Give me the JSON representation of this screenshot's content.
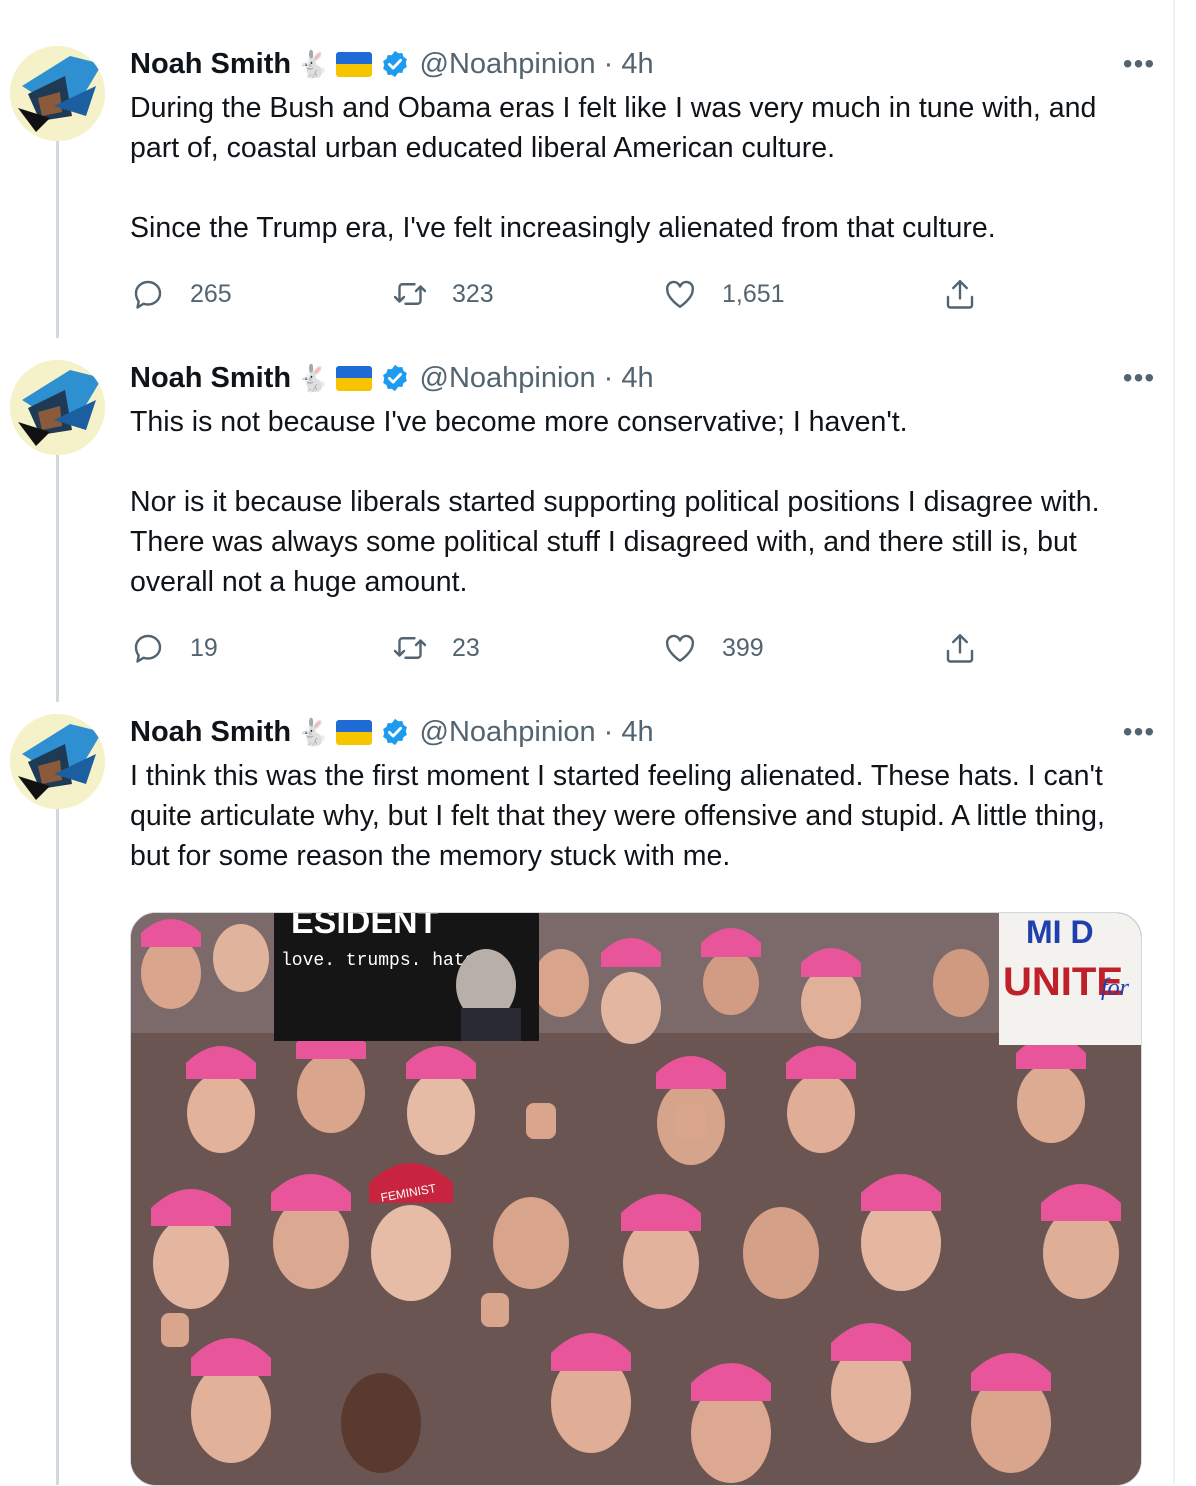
{
  "tweets": [
    {
      "name": "Noah Smith",
      "emoji_rabbit": "🐇",
      "handle": "@Noahpinion",
      "time": "· 4h",
      "more": "•••",
      "paragraphs": [
        "During the Bush and Obama eras I felt like I was very much in tune with, and part of, coastal urban educated liberal American culture.",
        "Since the Trump era, I've felt increasingly alienated from that culture."
      ],
      "replies": "265",
      "retweets": "323",
      "likes": "1,651"
    },
    {
      "name": "Noah Smith",
      "emoji_rabbit": "🐇",
      "handle": "@Noahpinion",
      "time": "· 4h",
      "more": "•••",
      "paragraphs": [
        "This is not because I've become more conservative; I haven't.",
        "Nor is it because liberals started supporting political positions I disagree with. There was always some political stuff I disagreed with, and there still is, but overall not a huge amount."
      ],
      "replies": "19",
      "retweets": "23",
      "likes": "399"
    },
    {
      "name": "Noah Smith",
      "emoji_rabbit": "🐇",
      "handle": "@Noahpinion",
      "time": "· 4h",
      "more": "•••",
      "paragraphs": [
        "I think this was the first moment I started feeling alienated. These hats. I can't quite articulate why, but I felt that they were offensive and stupid. A little thing, but for some reason the memory stuck with me."
      ],
      "media": {
        "sign_top": "ESIDENT",
        "sign_sub": "love. trumps. hate.",
        "sign_right_top": "MI D",
        "sign_right_main": "UNITE",
        "sign_right_for": "for",
        "hat_text": "FEMINIST"
      }
    }
  ],
  "colors": {
    "verified": "#1d9bf0",
    "flag_blue": "#1f6bd6",
    "flag_yellow": "#f7c400",
    "muted": "#536471",
    "thread_line": "#cfd9de",
    "pink_hat": "#e8559a"
  },
  "icons": [
    "reply-icon",
    "retweet-icon",
    "like-icon",
    "share-icon",
    "verified-icon",
    "flag-icon",
    "more-icon"
  ]
}
